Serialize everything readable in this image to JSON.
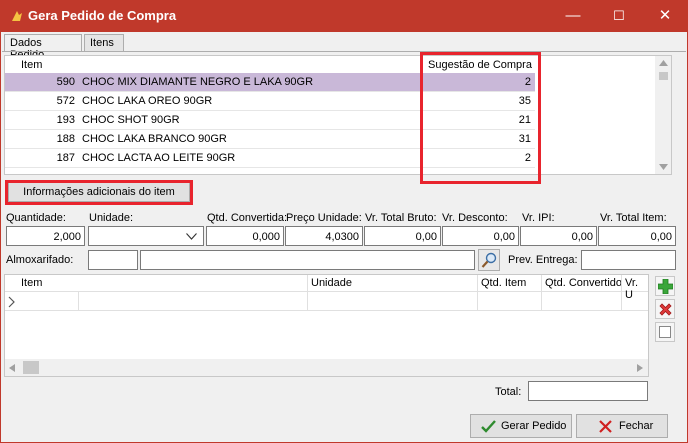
{
  "window": {
    "title": "Gera Pedido de Compra",
    "minimize_glyph": "—",
    "maximize_glyph": "☐",
    "close_glyph": "✕",
    "accent": "#c0392b"
  },
  "tabs": [
    {
      "label": "Dados Pedido",
      "active": false
    },
    {
      "label": "Itens",
      "active": true
    }
  ],
  "top_grid": {
    "headers": {
      "item": "Item",
      "sugestao": "Sugestão de Compra"
    },
    "rows": [
      {
        "item": "590",
        "desc": "CHOC MIX DIAMANTE NEGRO E LAKA 90GR",
        "sugestao": "2"
      },
      {
        "item": "572",
        "desc": "CHOC LAKA OREO 90GR",
        "sugestao": "35"
      },
      {
        "item": "193",
        "desc": "CHOC SHOT 90GR",
        "sugestao": "21"
      },
      {
        "item": "188",
        "desc": "CHOC LAKA BRANCO 90GR",
        "sugestao": "31"
      },
      {
        "item": "187",
        "desc": "CHOC LACTA AO LEITE 90GR",
        "sugestao": "2"
      }
    ]
  },
  "info_button": "Informações adicionais do item",
  "fields": {
    "quantidade": {
      "label": "Quantidade:",
      "value": "2,000"
    },
    "unidade": {
      "label": "Unidade:",
      "value": ""
    },
    "qtd_convertida": {
      "label": "Qtd. Convertida:",
      "value": "0,000"
    },
    "preco_unidade": {
      "label": "Preço Unidade:",
      "value": "4,0300"
    },
    "vr_total_bruto": {
      "label": "Vr. Total Bruto:",
      "value": "0,00"
    },
    "vr_desconto": {
      "label": "Vr. Desconto:",
      "value": "0,00"
    },
    "vr_ipi": {
      "label": "Vr. IPI:",
      "value": "0,00"
    },
    "vr_total_item": {
      "label": "Vr. Total Item:",
      "value": "0,00"
    },
    "almoxarifado": {
      "label": "Almoxarifado:",
      "code": "",
      "name": ""
    },
    "prev_entrega": {
      "label": "Prev. Entrega:",
      "value": ""
    }
  },
  "bottom_grid": {
    "headers": {
      "item": "Item",
      "unidade": "Unidade",
      "qtd_item": "Qtd. Item",
      "qtd_convertido": "Qtd. Convertido",
      "vr_u": "Vr. U"
    }
  },
  "total": {
    "label": "Total:",
    "value": ""
  },
  "footer": {
    "gerar": "Gerar Pedido",
    "fechar": "Fechar"
  }
}
